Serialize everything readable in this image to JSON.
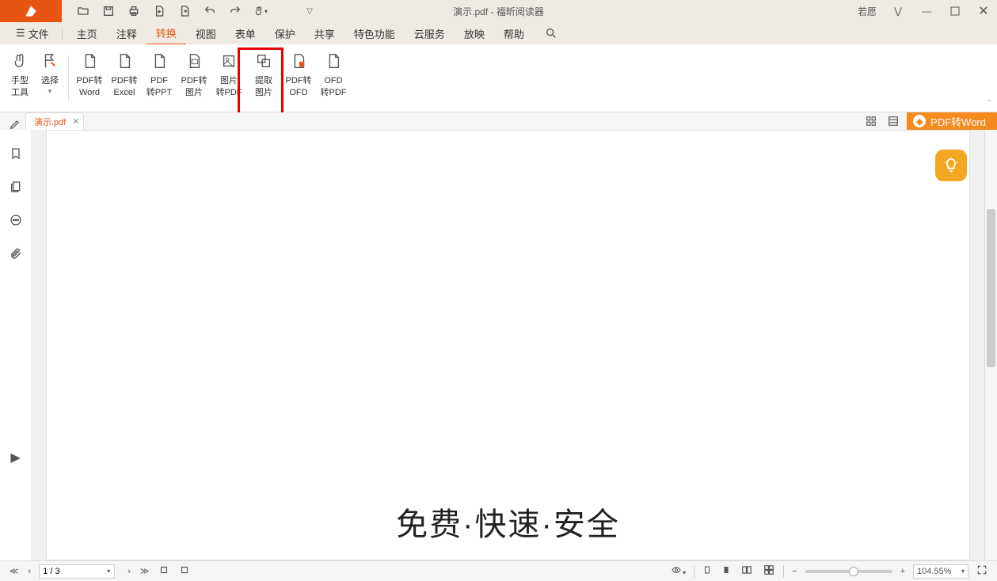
{
  "title": {
    "doc": "演示.pdf",
    "app": "福昕阅读器",
    "full": "演示.pdf - 福昕阅读器"
  },
  "user": {
    "name": "若愿"
  },
  "menu": {
    "file": "文件"
  },
  "tabs": {
    "items": [
      "主页",
      "注释",
      "转换",
      "视图",
      "表单",
      "保护",
      "共享",
      "特色功能",
      "云服务",
      "放映",
      "帮助"
    ],
    "active_index": 2
  },
  "ribbon": {
    "hand_tool": {
      "l1": "手型",
      "l2": "工具"
    },
    "select": {
      "l1": "选择"
    },
    "pdf_word": {
      "l1": "PDF转",
      "l2": "Word"
    },
    "pdf_excel": {
      "l1": "PDF转",
      "l2": "Excel"
    },
    "pdf_ppt": {
      "l1": "PDF",
      "l2": "转PPT"
    },
    "pdf_image": {
      "l1": "PDF转",
      "l2": "图片"
    },
    "image_pdf": {
      "l1": "图片",
      "l2": "转PDF"
    },
    "extract_image": {
      "l1": "提取",
      "l2": "图片"
    },
    "pdf_ofd": {
      "l1": "PDF转",
      "l2": "OFD"
    },
    "ofd_pdf": {
      "l1": "OFD",
      "l2": "转PDF"
    }
  },
  "doctab": {
    "name": "演示.pdf"
  },
  "promo": {
    "button": "PDF转Word"
  },
  "page_content": {
    "slogan": "免费·快速·安全"
  },
  "status": {
    "page": "1 / 3",
    "zoom": "104.55%"
  },
  "icons": {
    "folder": "folder-icon",
    "save": "save-icon",
    "print": "print-icon",
    "file_plus": "file-plus-icon",
    "file_export": "file-export-icon",
    "undo": "undo-icon",
    "redo": "redo-icon",
    "hand": "hand-icon",
    "dropdown": "dropdown-icon",
    "minimize": "minimize-icon",
    "maximize": "maximize-icon",
    "close": "close-icon",
    "search": "search-icon",
    "bookmark": "bookmark-icon",
    "pages": "pages-icon",
    "comment": "comment-icon",
    "attachment": "attachment-icon",
    "grid4": "grid4-icon",
    "list": "list-icon",
    "bulb": "bulb-icon",
    "first": "first-page-icon",
    "prev": "prev-page-icon",
    "next": "next-page-icon",
    "last": "last-page-icon",
    "eye": "eye-icon",
    "single": "single-page-icon",
    "cont": "continuous-icon",
    "facing": "facing-icon",
    "facing_cont": "facing-continuous-icon",
    "fullscreen": "fullscreen-icon"
  }
}
